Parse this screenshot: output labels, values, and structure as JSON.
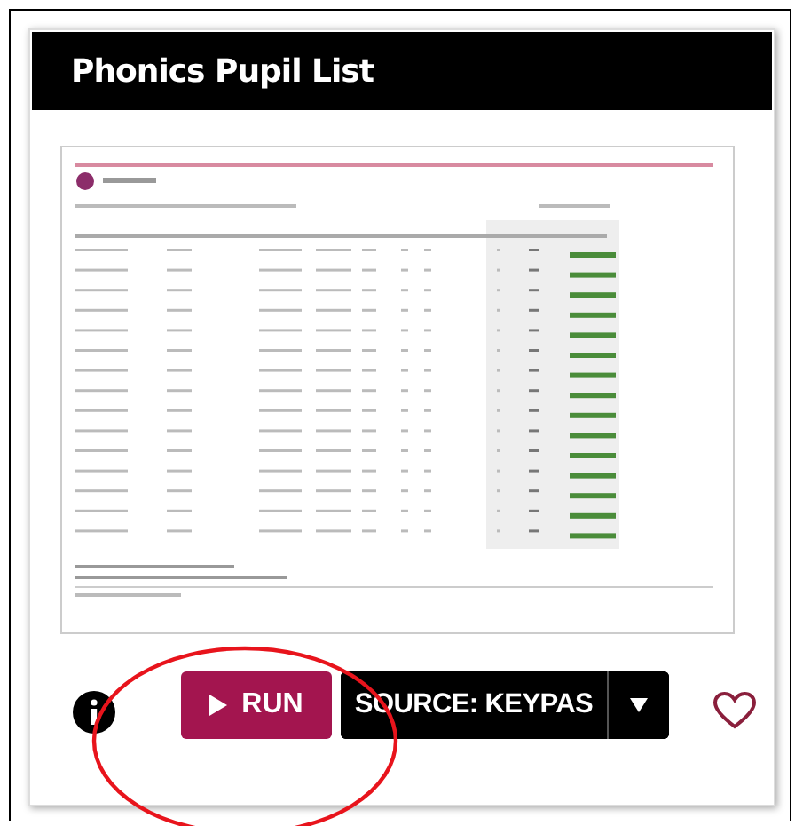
{
  "card": {
    "title": "Phonics Pupil List"
  },
  "actions": {
    "run": {
      "label": "RUN"
    },
    "source": {
      "label": "SOURCE: KEYPAS"
    }
  }
}
